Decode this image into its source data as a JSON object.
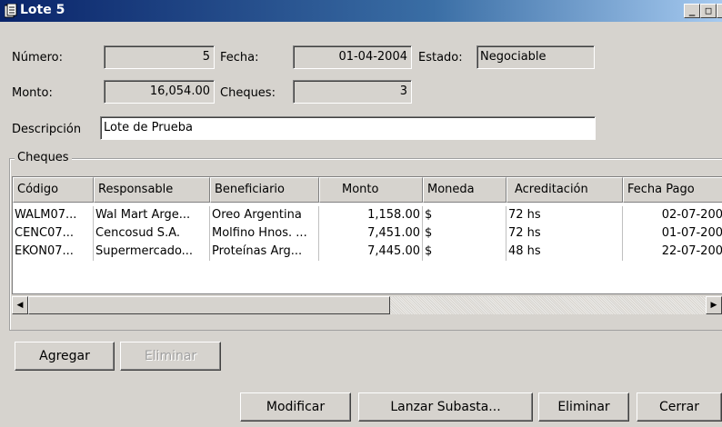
{
  "window": {
    "title": "Lote 5",
    "controls": {
      "minimize": "_",
      "maximize": "□",
      "close": "X"
    }
  },
  "form": {
    "numero": {
      "label": "Número:",
      "value": "5"
    },
    "fecha": {
      "label": "Fecha:",
      "value": "01-04-2004"
    },
    "estado": {
      "label": "Estado:",
      "value": "Negociable"
    },
    "monto": {
      "label": "Monto:",
      "value": "16,054.00"
    },
    "cheques": {
      "label": "Cheques:",
      "value": "3"
    },
    "descripcion": {
      "label": "Descripción",
      "value": "Lote de Prueba"
    }
  },
  "cheques_group": {
    "title": "Cheques",
    "columns": [
      "Código",
      "Responsable",
      "Beneficiario",
      "Monto",
      "Moneda",
      "Acreditación",
      "Fecha Pago"
    ],
    "rows": [
      [
        "WALM07...",
        "Wal Mart Arge...",
        "Oreo Argentina",
        "1,158.00",
        "$",
        "72 hs",
        "02-07-200"
      ],
      [
        "CENC07...",
        "Cencosud S.A.",
        "Molfino Hnos. ...",
        "7,451.00",
        "$",
        "72 hs",
        "01-07-200"
      ],
      [
        "EKON07...",
        "Supermercado...",
        "Proteínas Arg...",
        "7,445.00",
        "$",
        "48 hs",
        "22-07-200"
      ]
    ]
  },
  "buttons": {
    "agregar": "Agregar",
    "eliminar_row": "Eliminar",
    "modificar": "Modificar",
    "lanzar": "Lanzar Subasta...",
    "eliminar": "Eliminar",
    "cerrar": "Cerrar"
  },
  "icons": {
    "window": "document-icon",
    "scroll_left": "arrow-left-icon",
    "scroll_right": "arrow-right-icon"
  }
}
